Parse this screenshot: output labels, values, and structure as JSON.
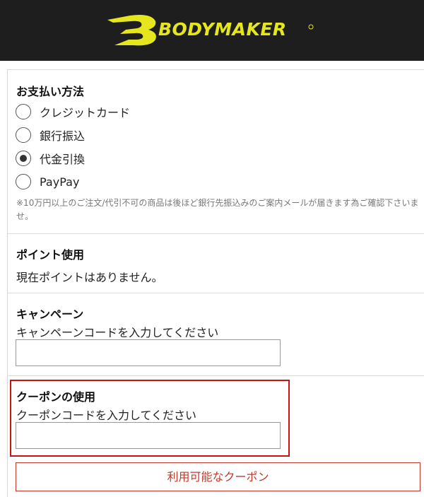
{
  "header": {
    "logo_text": "BODYMAKER",
    "logo_color": "#e6e61e"
  },
  "payment": {
    "heading": "お支払い方法",
    "options": [
      {
        "label": "クレジットカード",
        "selected": false
      },
      {
        "label": "銀行振込",
        "selected": false
      },
      {
        "label": "代金引換",
        "selected": true
      },
      {
        "label": "PayPay",
        "selected": false
      }
    ],
    "note": "※10万円以上のご注文/代引不可の商品は後ほど銀行先振込みのご案内メールが届きます為ご確認下さいませ。"
  },
  "points": {
    "heading": "ポイント使用",
    "message": "現在ポイントはありません。"
  },
  "campaign": {
    "heading": "キャンペーン",
    "prompt": "キャンペーンコードを入力してください",
    "value": ""
  },
  "coupon": {
    "heading": "クーポンの使用",
    "prompt": "クーポンコードを入力してください",
    "value": "",
    "available_button": "利用可能なクーポン"
  },
  "colors": {
    "header_bg": "#1e1e1e",
    "accent_red": "#c0392b",
    "highlight_border": "#cc1111"
  }
}
